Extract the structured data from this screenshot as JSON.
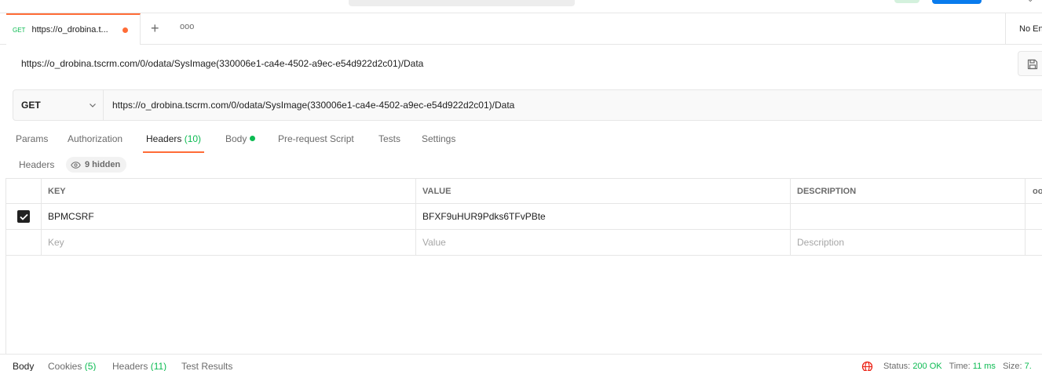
{
  "tab": {
    "method": "GET",
    "title": "https://o_drobina.t..."
  },
  "tabbar": {
    "add": "+",
    "more": "ooo"
  },
  "environment": {
    "label": "No En"
  },
  "request": {
    "title": "https://o_drobina.tscrm.com/0/odata/SysImage(330006e1-ca4e-4502-a9ec-e54d922d2c01)/Data",
    "method": "GET",
    "url": "https://o_drobina.tscrm.com/0/odata/SysImage(330006e1-ca4e-4502-a9ec-e54d922d2c01)/Data"
  },
  "request_tabs": {
    "params": "Params",
    "authorization": "Authorization",
    "headers": "Headers",
    "headers_count": "(10)",
    "body": "Body",
    "prerequest": "Pre-request Script",
    "tests": "Tests",
    "settings": "Settings"
  },
  "headers_section": {
    "label": "Headers",
    "hidden": "9 hidden"
  },
  "table": {
    "columns": {
      "key": "KEY",
      "value": "VALUE",
      "description": "DESCRIPTION",
      "more": "ooo"
    },
    "rows": [
      {
        "checked": true,
        "key": "BPMCSRF",
        "value": "BFXF9uHUR9Pdks6TFvPBte",
        "description": ""
      }
    ],
    "placeholders": {
      "key": "Key",
      "value": "Value",
      "description": "Description"
    }
  },
  "response": {
    "tabs": {
      "body": "Body",
      "cookies": "Cookies",
      "cookies_count": "(5)",
      "headers": "Headers",
      "headers_count": "(11)",
      "test_results": "Test Results"
    },
    "status_label": "Status:",
    "status_value": "200 OK",
    "time_label": "Time:",
    "time_value": "11 ms",
    "size_label": "Size:",
    "size_value": "7."
  },
  "colors": {
    "accent": "#ff6c37",
    "success": "#0cbb52",
    "primary_button": "#097bed"
  },
  "icons": {
    "save": "save-icon",
    "chevron": "chevron-down-icon",
    "eye": "eye-icon",
    "globe": "globe-icon",
    "checkbox": "checkbox-checked-icon"
  }
}
